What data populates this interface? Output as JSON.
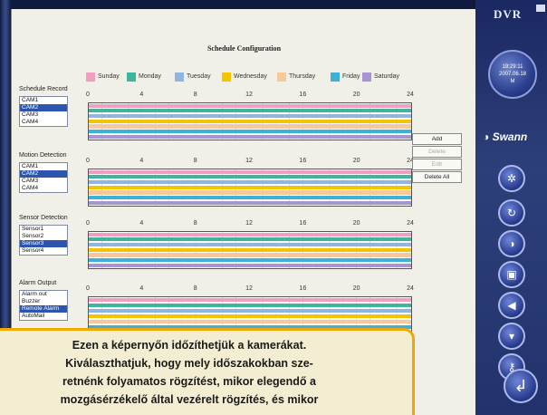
{
  "title": "Schedule Configuration",
  "legend": [
    {
      "label": "Sunday",
      "color": "#f19ec2"
    },
    {
      "label": "Monday",
      "color": "#3fb59d"
    },
    {
      "label": "Tuesday",
      "color": "#8fb5e0"
    },
    {
      "label": "Wednesday",
      "color": "#f5c400"
    },
    {
      "label": "Thursday",
      "color": "#f7c99a"
    },
    {
      "label": "Friday",
      "color": "#3fb0d6"
    },
    {
      "label": "Saturday",
      "color": "#a694d3"
    }
  ],
  "axis_ticks": [
    "0",
    "4",
    "8",
    "12",
    "16",
    "20",
    "24"
  ],
  "sections": [
    {
      "label": "Schedule Record",
      "items": [
        "CAM1",
        "CAM2",
        "CAM3",
        "CAM4"
      ],
      "selected": 1
    },
    {
      "label": "Motion Detection",
      "items": [
        "CAM1",
        "CAM2",
        "CAM3",
        "CAM4"
      ],
      "selected": 1
    },
    {
      "label": "Sensor Detection",
      "items": [
        "Sensor1",
        "Sensor2",
        "Sensor3",
        "Sensor4"
      ],
      "selected": 2
    },
    {
      "label": "Alarm Output",
      "items": [
        "Alarm out",
        "Buzzer",
        "Remote Alarm",
        "AutoMail"
      ],
      "selected": 2
    }
  ],
  "buttons": {
    "add": "Add",
    "delete": "Delete",
    "edit": "Edit",
    "delete_all": "Delete All"
  },
  "side": {
    "logo": "DVR",
    "time": "19:29:11",
    "date": "2007.06.18",
    "day": "M",
    "brand": "Swann",
    "icons": [
      "settings-icon",
      "refresh-icon",
      "display-icon",
      "window-icon",
      "speaker-icon",
      "dome-camera-icon",
      "key-icon",
      "back-icon"
    ]
  },
  "caption": {
    "line1": "Ezen a képernyőn időzíthetjük a kamerákat.",
    "line2": "Kiválaszthatjuk, hogy mely időszakokban sze-",
    "line3": "retnénk folyamatos rögzítést, mikor elegendő a",
    "line4": "mozgásérzékelő által vezérelt rögzítés, és mikor"
  }
}
